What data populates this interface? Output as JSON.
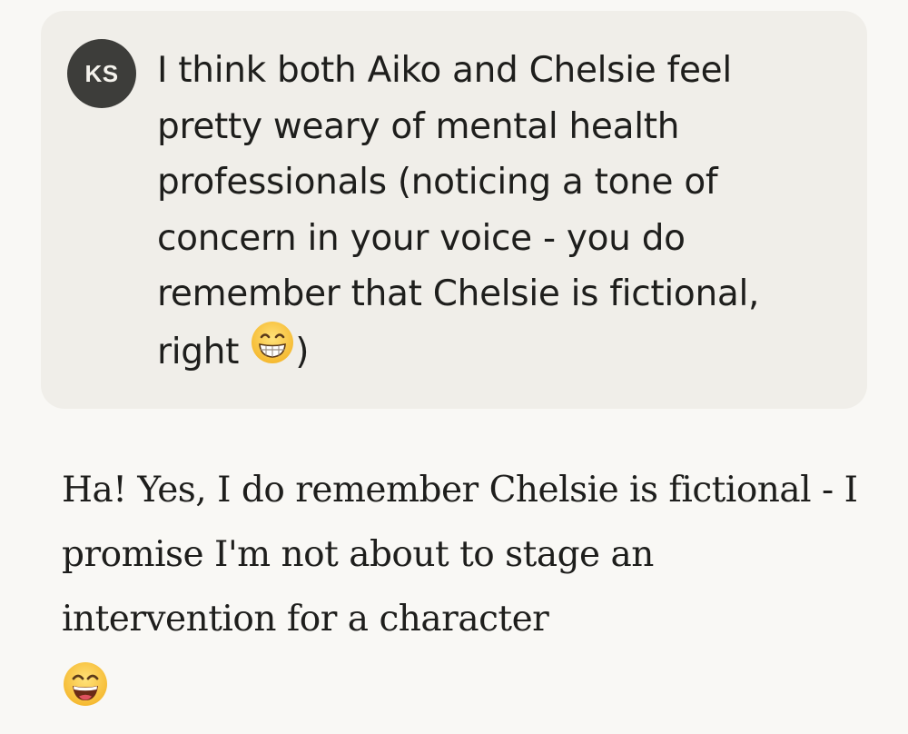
{
  "conversation": {
    "user_message": {
      "avatar_initials": "KS",
      "text": "I think both Aiko and Chelsie feel pretty weary of mental health professionals (noticing a tone of concern in your voice - you do remember that Chelsie is fictional, right",
      "emoji": "grinning-face-with-smiling-eyes",
      "trailing_text": ")"
    },
    "assistant_message": {
      "text": "Ha! Yes, I do remember Chelsie is fictional - I promise I'm not about to stage an intervention for a character",
      "emoji": "grinning-squinting-face"
    }
  },
  "colors": {
    "page_background": "#f9f8f5",
    "user_bubble": "#f0eee9",
    "avatar_background": "#3d3d3a",
    "text": "#1e1e1c",
    "emoji_yellow": "#f8c73a"
  }
}
